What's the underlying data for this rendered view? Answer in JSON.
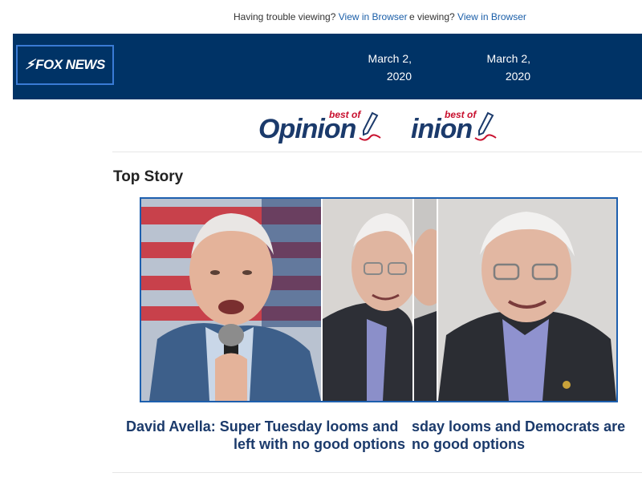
{
  "top_bar": {
    "fragment_1": {
      "prefix": "Having trouble viewing? ",
      "link": "View in Browser"
    },
    "fragment_2": {
      "prefix": "e viewing? ",
      "link": "View in Browser"
    }
  },
  "header": {
    "logo_text": "FOX NEWS",
    "date_1": "March 2, 2020",
    "date_2": "March 2, 2020",
    "background": "#003366"
  },
  "banner": {
    "word_1": "Opinion",
    "bestof_1": "best of",
    "word_2": "inion",
    "bestof_2": "best of",
    "icon": "pen-icon"
  },
  "section": {
    "title": "Top Story"
  },
  "story": {
    "headline_line1_a": "David Avella: Super Tuesday looms and ",
    "headline_line1_b": "sday looms and Democrats are",
    "headline_line2_a": "left with no good options",
    "headline_line2_b": "no good options",
    "image_alt": "Joe Biden and Bernie Sanders"
  },
  "colors": {
    "accent": "#1b3a6b",
    "link": "#1a5ea8",
    "brand_red": "#c8102e"
  }
}
